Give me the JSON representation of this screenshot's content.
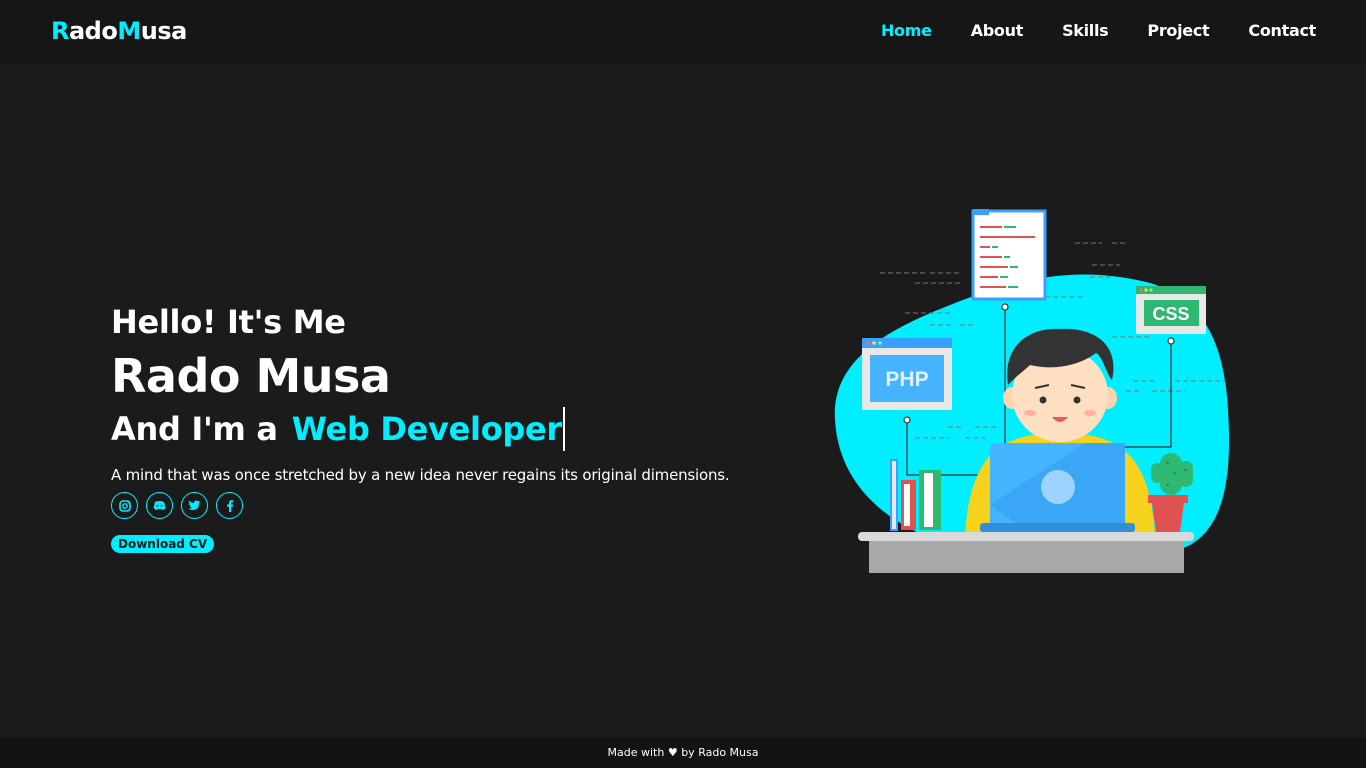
{
  "brand": {
    "logo_part1_initial": "R",
    "logo_part1_rest": "ado",
    "logo_part2_initial": "M",
    "logo_part2_rest": "usa"
  },
  "nav": {
    "items": [
      {
        "label": "Home",
        "active": true
      },
      {
        "label": "About",
        "active": false
      },
      {
        "label": "Skills",
        "active": false
      },
      {
        "label": "Project",
        "active": false
      },
      {
        "label": "Contact",
        "active": false
      }
    ]
  },
  "hero": {
    "greeting": "Hello! It's Me",
    "name": "Rado Musa",
    "role_prefix": "And I'm a",
    "role_typed": "Web Developer",
    "quote": "A mind that was once stretched by a new idea never regains its original dimensions.",
    "socials": [
      {
        "icon": "instagram-icon"
      },
      {
        "icon": "discord-icon"
      },
      {
        "icon": "twitter-icon"
      },
      {
        "icon": "facebook-icon"
      }
    ],
    "cta_label": "Download CV"
  },
  "illustration": {
    "php_label": "PHP",
    "css_label": "CSS"
  },
  "footer": {
    "prefix": "Made with",
    "suffix": "by Rado Musa"
  },
  "colors": {
    "accent": "#00eeff",
    "background": "#1b1b1b",
    "nav_background": "#161616"
  }
}
